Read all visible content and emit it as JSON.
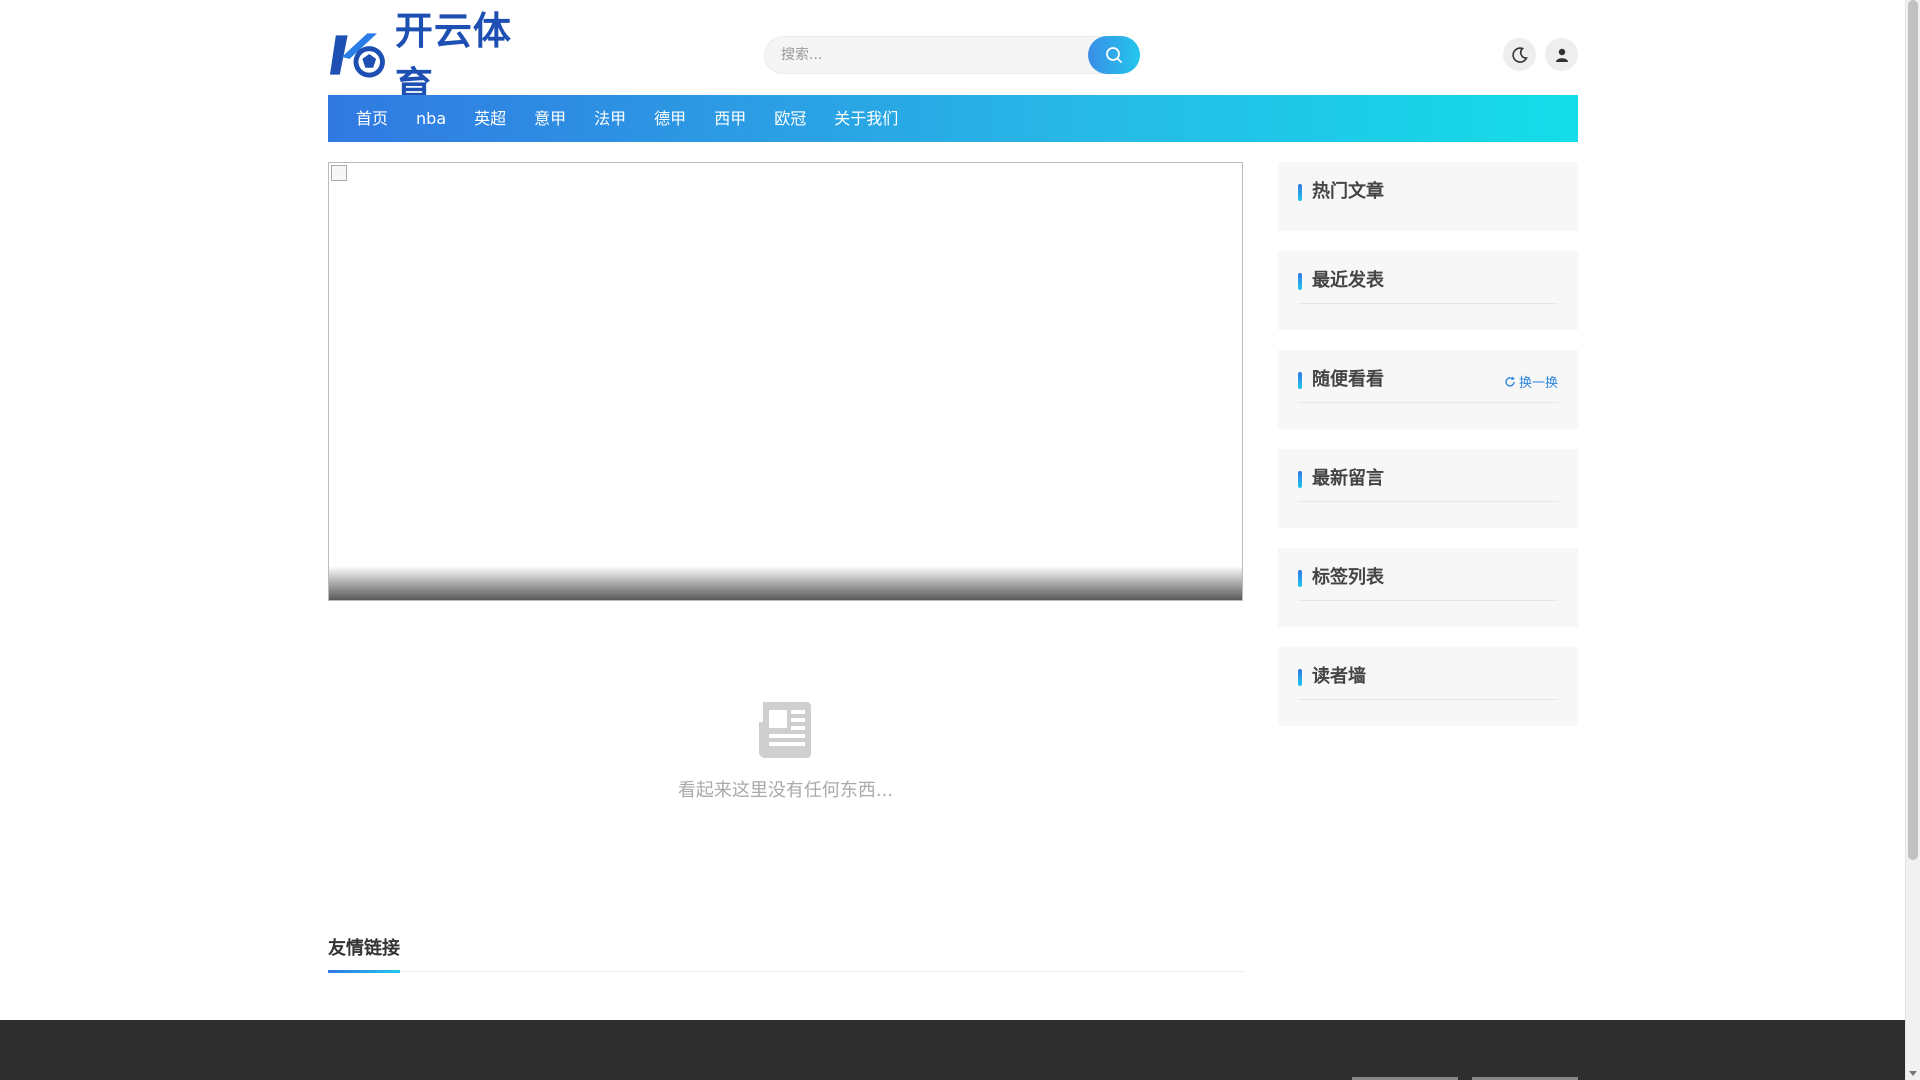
{
  "header": {
    "logo_text": "开云体育",
    "search_placeholder": "搜索...",
    "icons": {
      "logo": "k-ball-logo-icon",
      "search": "search-icon",
      "dark_mode": "moon-icon",
      "user": "user-icon"
    }
  },
  "nav": {
    "items": [
      {
        "label": "首页"
      },
      {
        "label": "nba"
      },
      {
        "label": "英超"
      },
      {
        "label": "意甲"
      },
      {
        "label": "法甲"
      },
      {
        "label": "德甲"
      },
      {
        "label": "西甲"
      },
      {
        "label": "欧冠"
      },
      {
        "label": "关于我们"
      }
    ]
  },
  "main": {
    "empty_text": "看起来这里没有任何东西...",
    "empty_icon": "newspaper-icon"
  },
  "links": {
    "title": "友情链接"
  },
  "sidebar": {
    "widgets": [
      {
        "title": "热门文章"
      },
      {
        "title": "最近发表"
      },
      {
        "title": "随便看看",
        "action": "换一换"
      },
      {
        "title": "最新留言"
      },
      {
        "title": "标签列表"
      },
      {
        "title": "读者墙"
      }
    ]
  },
  "colors": {
    "accent_start": "#3179e1",
    "accent_end": "#14dde9",
    "footer": "#2e2e2e"
  }
}
